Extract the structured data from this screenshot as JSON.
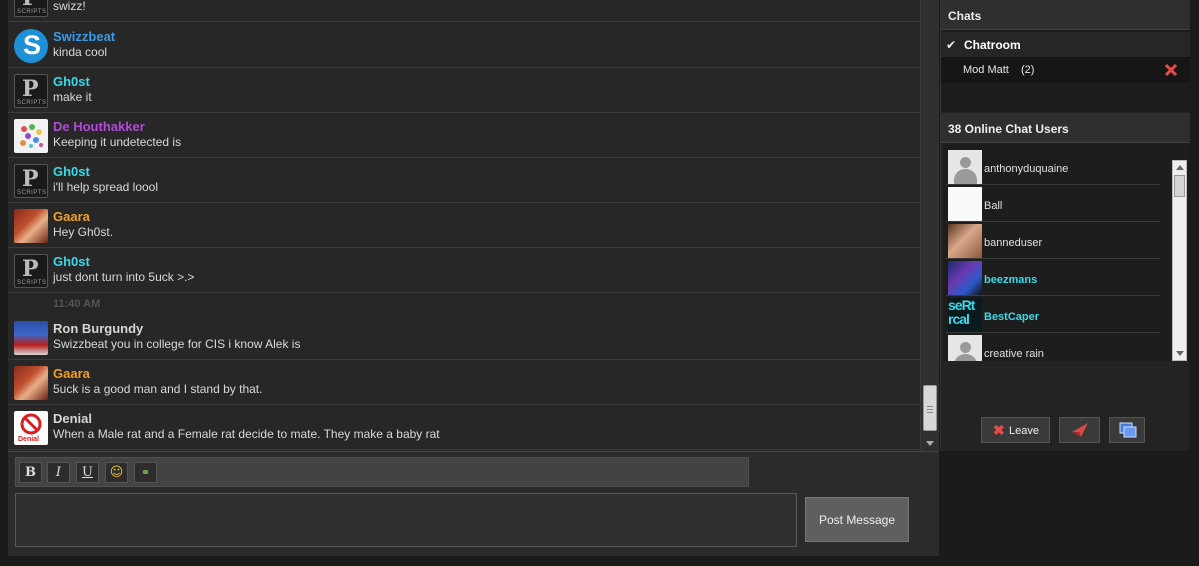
{
  "messages": [
    {
      "user": "",
      "text": "swizz!",
      "color": "#d8d8d8",
      "avatar": "p-scripts"
    },
    {
      "user": "Swizzbeat",
      "text": "kinda cool",
      "color": "#3a9ae8",
      "avatar": "s-logo"
    },
    {
      "user": "Gh0st",
      "text": "make it",
      "color": "#3ad8e8",
      "avatar": "p-scripts"
    },
    {
      "user": "De Houthakker",
      "text": "Keeping it undetected is",
      "color": "#b24ad8",
      "avatar": "dots"
    },
    {
      "user": "Gh0st",
      "text": "i'll help spread loool",
      "color": "#3ad8e8",
      "avatar": "p-scripts"
    },
    {
      "user": "Gaara",
      "text": "Hey Gh0st.",
      "color": "#f0a020",
      "avatar": "gaara"
    },
    {
      "user": "Gh0st",
      "text": "just dont turn into 5uck >.>",
      "color": "#3ad8e8",
      "avatar": "p-scripts"
    },
    {
      "user": "Ron Burgundy",
      "text": "Swizzbeat you in college for CIS i know Alek is",
      "color": "#d8d8d8",
      "avatar": "ron"
    },
    {
      "user": "Gaara",
      "text": "5uck is a good man and I stand by that.",
      "color": "#f0a020",
      "avatar": "gaara"
    },
    {
      "user": "Denial",
      "text": "When a Male rat and a Female rat decide to mate. They make a baby rat",
      "color": "#d8d8d8",
      "avatar": "denial"
    }
  ],
  "timestamp": "11:40 AM",
  "avatar_text": {
    "p_scripts_letter": "P",
    "p_scripts_sub": "SCRIPTS",
    "s_logo_letter": "S",
    "denial_label": "Denial",
    "best_text": "seRt rcal"
  },
  "toolbar": {
    "bold": "B",
    "italic": "I",
    "underline": "U",
    "emoji": "☺",
    "link": "⚭"
  },
  "composer": {
    "input_value": "",
    "post_label": "Post Message"
  },
  "sidebar": {
    "chats_title": "Chats",
    "chats": [
      {
        "name": "Chatroom",
        "active": true,
        "check": "✔"
      },
      {
        "name": "Mod Matt",
        "count": "(2)",
        "active": false
      }
    ],
    "users_title": "38 Online Chat Users",
    "users": [
      {
        "name": "anthonyduquaine",
        "color": "#e0e0e0",
        "avatar": "default"
      },
      {
        "name": "Ball",
        "color": "#e0e0e0",
        "avatar": "ball"
      },
      {
        "name": "banneduser",
        "color": "#e0e0e0",
        "avatar": "banned"
      },
      {
        "name": "beezmans",
        "color": "#3ad8e8",
        "avatar": "beez"
      },
      {
        "name": "BestCaper",
        "color": "#3ad8e8",
        "avatar": "best"
      },
      {
        "name": "creative rain",
        "color": "#e0e0e0",
        "avatar": "default"
      }
    ],
    "leave_label": "Leave"
  },
  "icons": {
    "close": "close-icon",
    "check": "check-icon",
    "leave": "leave-icon",
    "send": "send-icon",
    "popout": "popout-icon"
  }
}
